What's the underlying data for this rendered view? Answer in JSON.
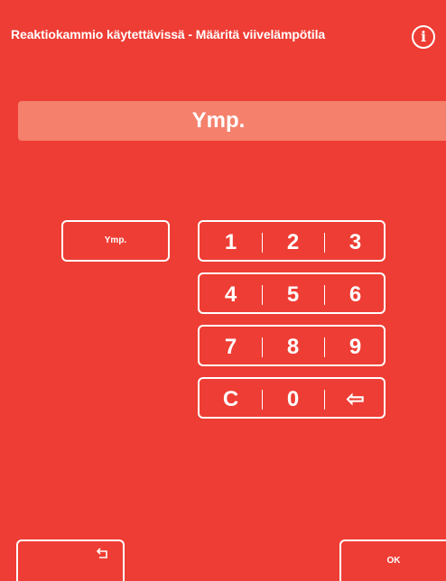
{
  "header": {
    "title": "Reaktiokammio käytettävissä - Määritä viivelämpötila",
    "info_icon": "info-icon",
    "info_glyph": "i"
  },
  "display": {
    "value": "Ymp."
  },
  "ambient_button": {
    "label": "Ymp."
  },
  "keypad": {
    "rows": [
      [
        "1",
        "2",
        "3"
      ],
      [
        "4",
        "5",
        "6"
      ],
      [
        "7",
        "8",
        "9"
      ],
      [
        "C",
        "0",
        "⇦"
      ]
    ],
    "backspace_icon": "backspace-arrow-icon"
  },
  "footer": {
    "back_icon": "return-arrow-icon",
    "ok_label": "OK"
  },
  "colors": {
    "background": "#ee3d34",
    "value_bar": "#f5806c",
    "foreground": "#ffffff"
  }
}
